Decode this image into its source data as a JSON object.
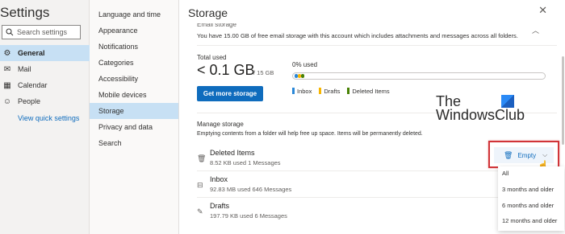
{
  "sidebar": {
    "title": "Settings",
    "search_placeholder": "Search settings",
    "items": [
      {
        "label": "General",
        "icon": "gear-icon"
      },
      {
        "label": "Mail",
        "icon": "mail-icon"
      },
      {
        "label": "Calendar",
        "icon": "calendar-icon"
      },
      {
        "label": "People",
        "icon": "people-icon"
      }
    ],
    "quick_settings_link": "View quick settings"
  },
  "subnav": {
    "items": [
      "Language and time",
      "Appearance",
      "Notifications",
      "Categories",
      "Accessibility",
      "Mobile devices",
      "Storage",
      "Privacy and data",
      "Search"
    ],
    "active": "Storage"
  },
  "content": {
    "title": "Storage",
    "email_storage_heading": "Email storage",
    "email_storage_desc": "You have 15.00 GB of free email storage with this account which includes attachments and messages across all folders.",
    "total_used_label": "Total used",
    "total_used_value": "< 0.1 GB",
    "total_quota": "/ 15 GB",
    "percent_used": "0% used",
    "usage_fraction": 0.0,
    "get_more_button": "Get more storage",
    "legend": [
      {
        "label": "Inbox",
        "color": "#2b88d8"
      },
      {
        "label": "Drafts",
        "color": "#f7b500"
      },
      {
        "label": "Deleted Items",
        "color": "#498205"
      }
    ],
    "manage_title": "Manage storage",
    "manage_desc": "Emptying contents from a folder will help free up space. Items will be permanently deleted.",
    "folders": [
      {
        "name": "Deleted Items",
        "meta": "8.52 KB used   1 Messages",
        "icon": "trash-icon"
      },
      {
        "name": "Inbox",
        "meta": "92.83 MB used   646 Messages",
        "icon": "inbox-icon"
      },
      {
        "name": "Drafts",
        "meta": "197.79 KB used   6 Messages",
        "icon": "pencil-icon"
      }
    ],
    "empty_button": "Empty",
    "empty_options": [
      "All",
      "3 months and older",
      "6 months and older",
      "12 months and older"
    ]
  },
  "watermark": {
    "line1": "The",
    "line2": "WindowsClub"
  },
  "colors": {
    "accent": "#0f6cbd",
    "highlight": "#d13438",
    "selected_nav": "#c7e0f4"
  }
}
